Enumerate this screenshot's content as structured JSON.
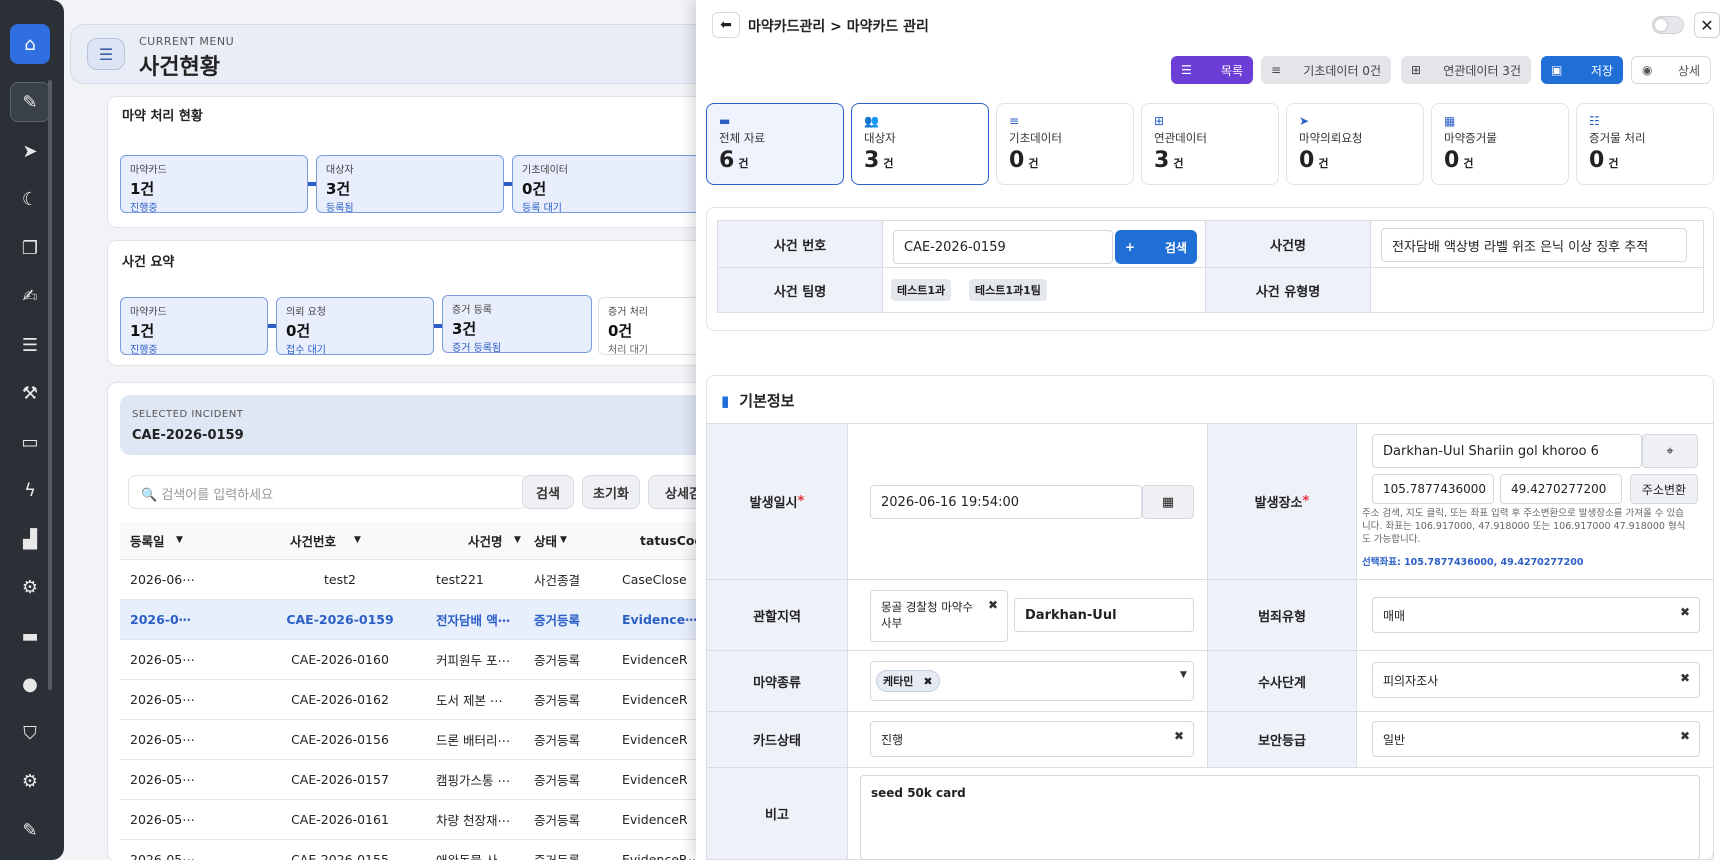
{
  "sidebar": {
    "icons": [
      "home-icon",
      "pencil-icon",
      "paper-plane-icon",
      "moon-icon",
      "copy-icon",
      "edit-icon",
      "list-icon",
      "gavel-icon",
      "monitor-icon",
      "bolt-icon",
      "chart-icon",
      "cogs-icon",
      "drive-icon",
      "user-icon",
      "shield-icon",
      "settings-icon",
      "pen-icon"
    ]
  },
  "current_menu": {
    "label": "CURRENT MENU",
    "title": "사건현황"
  },
  "status": {
    "title": "마약 처리 현황",
    "stages": [
      {
        "label": "마약카드",
        "value": "1건",
        "sub": "진행중"
      },
      {
        "label": "대상자",
        "value": "3건",
        "sub": "등록됨"
      },
      {
        "label": "기초데이터",
        "value": "0건",
        "sub": "등록 대기"
      }
    ]
  },
  "summary": {
    "title": "사건 요약",
    "stages": [
      {
        "label": "마약카드",
        "value": "1건",
        "sub": "진행중"
      },
      {
        "label": "의뢰 요청",
        "value": "0건",
        "sub": "접수 대기"
      },
      {
        "label": "증거 등록",
        "value": "3건",
        "sub": "증거 등록됨"
      },
      {
        "label": "증거 처리",
        "value": "0건",
        "sub": "처리 대기"
      }
    ]
  },
  "selected_incident": {
    "label": "SELECTED INCIDENT",
    "value": "CAE-2026-0159"
  },
  "search": {
    "placeholder": "검색어를 입력하세요",
    "search_btn": "검색",
    "reset_btn": "초기화",
    "detail_btn": "상세검"
  },
  "table": {
    "headers": [
      "등록일",
      "사건번호",
      "사건명",
      "상태",
      "tatusCod"
    ],
    "rows": [
      [
        "2026-06⋯",
        "test2",
        "test221",
        "사건종결",
        "CaseClose"
      ],
      [
        "2026-0⋯",
        "CAE-2026-0159",
        "전자담배 액⋯",
        "증거등록",
        "Evidence⋯"
      ],
      [
        "2026-05⋯",
        "CAE-2026-0160",
        "커피원두 포⋯",
        "증거등록",
        "EvidenceR"
      ],
      [
        "2026-05⋯",
        "CAE-2026-0162",
        "도서 제본 ⋯",
        "증거등록",
        "EvidenceR"
      ],
      [
        "2026-05⋯",
        "CAE-2026-0156",
        "드론 배터리⋯",
        "증거등록",
        "EvidenceR"
      ],
      [
        "2026-05⋯",
        "CAE-2026-0157",
        "캠핑가스통 ⋯",
        "증거등록",
        "EvidenceR"
      ],
      [
        "2026-05⋯",
        "CAE-2026-0161",
        "차량 천장재⋯",
        "증거등록",
        "EvidenceR"
      ],
      [
        "2026-05⋯",
        "CAE-2026-0155",
        "애완동물 사⋯",
        "증거등록",
        "EvidenceR⋯"
      ]
    ]
  },
  "panel": {
    "breadcrumb": "마약카드관리 > 마약카드 관리",
    "actions": {
      "list": "목록",
      "base": "기초데이터 0건",
      "related": "연관데이터 3건",
      "save": "저장",
      "detail": "상세"
    },
    "stats": [
      {
        "label": "전체 자료",
        "value": "6",
        "unit": "건"
      },
      {
        "label": "대상자",
        "value": "3",
        "unit": "건"
      },
      {
        "label": "기초데이터",
        "value": "0",
        "unit": "건"
      },
      {
        "label": "연관데이터",
        "value": "3",
        "unit": "건"
      },
      {
        "label": "마약의뢰요청",
        "value": "0",
        "unit": "건"
      },
      {
        "label": "마약증거물",
        "value": "0",
        "unit": "건"
      },
      {
        "label": "증거물 처리",
        "value": "0",
        "unit": "건"
      }
    ],
    "case": {
      "no_label": "사건 번호",
      "no_value": "CAE-2026-0159",
      "search_btn": "검색",
      "name_label": "사건명",
      "name_value": "전자담배 액상병 라벨 위조 은닉 이상 징후 추적",
      "team_label": "사건 팀명",
      "teams": [
        "테스트1과",
        "테스트1과1팀"
      ],
      "type_label": "사건 유형명",
      "type_value": ""
    },
    "basic": {
      "title": "기본정보",
      "date_label": "발생일시",
      "date_value": "2026-06-16 19:54:00",
      "place_label": "발생장소",
      "place_value": "Darkhan-Uul Shariin gol khoroo 6",
      "lng": "105.7877436000",
      "lat": "49.4270277200",
      "convert_btn": "주소변환",
      "hint": "주소 검색, 지도 클릭, 또는 좌표 입력 후 주소변환으로 발생장소를 가져올 수 있습니다. 좌표는 106.917000, 47.918000 또는 106.917000 47.918000 형식도 가능합니다.",
      "selected_coord": "선택좌표: 105.7877436000, 49.4270277200",
      "region_label": "관할지역",
      "region_value": "몽골 경찰청 마약수사부",
      "region_value2": "Darkhan-Uul",
      "crime_label": "범죄유형",
      "crime_value": "매매",
      "drug_label": "마약종류",
      "drug_value": "케타민",
      "stage_label": "수사단계",
      "stage_value": "피의자조사",
      "card_label": "카드상태",
      "card_value": "진행",
      "security_label": "보안등급",
      "security_value": "일반",
      "memo_label": "비고",
      "memo_value": "seed 50k card"
    }
  },
  "colors": {
    "primary": "#2f6fe0",
    "purple": "#6b3fd6",
    "sidebar": "#2b2f36"
  }
}
